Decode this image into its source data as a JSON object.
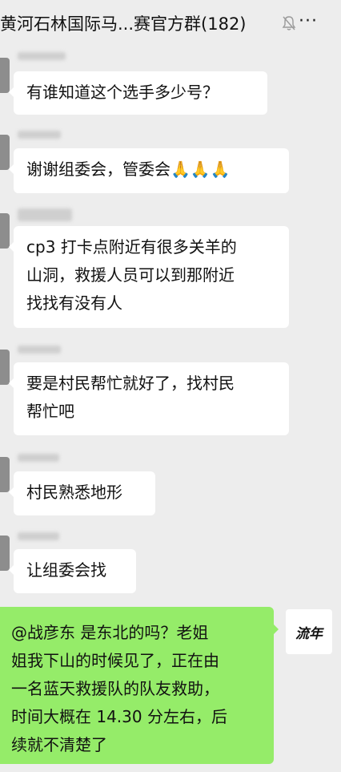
{
  "header": {
    "title": "黄河石林国际马...赛官方群(182)",
    "mute_icon": "bell-muted-icon",
    "more_icon": "more-icon",
    "more_glyph": "···"
  },
  "messages": [
    {
      "text": "有谁知道这个选手多少号？"
    },
    {
      "text": "谢谢组委会，管委会🙏🙏🙏"
    },
    {
      "lines": [
        "cp3 打卡点附近有很多关羊的",
        "山洞，救援人员可以到那附近",
        "找找有没有人"
      ]
    },
    {
      "lines": [
        "要是村民帮忙就好了，找村民",
        "帮忙吧"
      ]
    },
    {
      "text": "村民熟悉地形"
    },
    {
      "text": "让组委会找"
    },
    {
      "lines": [
        "@战彦东  是东北的吗？老姐",
        "姐我下山的时候见了，正在由",
        "一名蓝天救援队的队友救助，",
        "时间大概在 14.30 分左右，后",
        "续就不清楚了"
      ]
    }
  ],
  "self_avatar": {
    "text": "流年"
  }
}
